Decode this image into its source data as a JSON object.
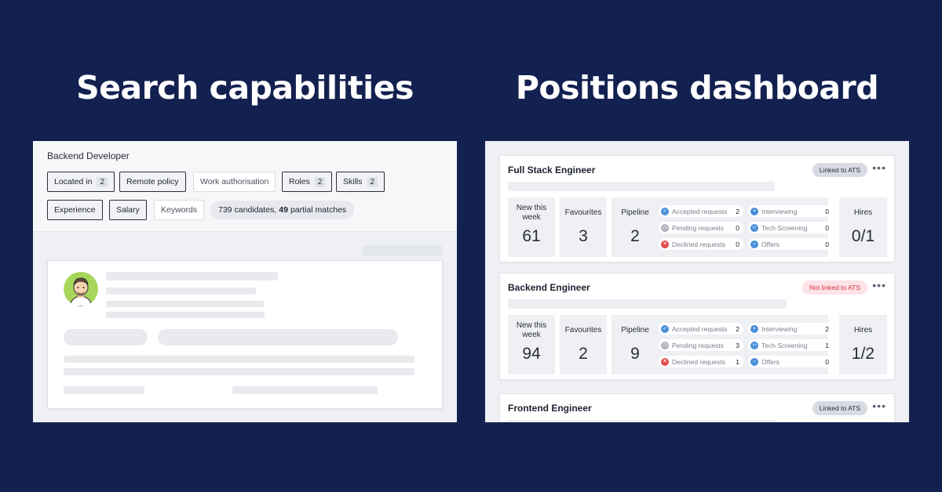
{
  "headings": {
    "left": "Search capabilities",
    "right": "Positions dashboard"
  },
  "search": {
    "title": "Backend Developer",
    "filters": [
      {
        "label": "Located in",
        "count": "2"
      },
      {
        "label": "Remote policy"
      },
      {
        "label": "Work authorisation"
      },
      {
        "label": "Roles",
        "count": "2"
      },
      {
        "label": "Skills",
        "count": "2"
      },
      {
        "label": "Experience"
      },
      {
        "label": "Salary"
      },
      {
        "label": "Keywords"
      }
    ],
    "summary": {
      "candidates": "739",
      "candidates_text": "candidates,",
      "partial": "49",
      "partial_text": "partial matches"
    }
  },
  "stat_labels": {
    "new": "New this week",
    "favourites": "Favourites",
    "pipeline": "Pipeline",
    "hires": "Hires"
  },
  "pipeline_labels": {
    "accepted": "Accepted requests",
    "pending": "Pending requests",
    "declined": "Declined requests",
    "interviewing": "Interviewing",
    "tech": "Tech Screening",
    "offers": "Offers"
  },
  "colors": {
    "background": "#132150",
    "accepted": "#4a90d9",
    "pending": "#a9adb6",
    "declined": "#e04b4b",
    "interviewing": "#4a90d9",
    "tech": "#4a90d9",
    "offers": "#4a90d9"
  },
  "positions": [
    {
      "title": "Full Stack Engineer",
      "ats": "Linked to ATS",
      "ats_status": "linked",
      "new_this_week": "61",
      "favourites": "3",
      "pipeline": "2",
      "accepted": "2",
      "pending": "0",
      "declined": "0",
      "interviewing": "0",
      "tech": "0",
      "offers": "0",
      "hires": "0/1"
    },
    {
      "title": "Backend Engineer",
      "ats": "Not linked to ATS",
      "ats_status": "notlinked",
      "new_this_week": "94",
      "favourites": "2",
      "pipeline": "9",
      "accepted": "2",
      "pending": "3",
      "declined": "1",
      "interviewing": "2",
      "tech": "1",
      "offers": "0",
      "hires": "1/2"
    },
    {
      "title": "Frontend Engineer",
      "ats": "Linked to ATS",
      "ats_status": "linked"
    }
  ],
  "card_menu_glyph": "•••"
}
